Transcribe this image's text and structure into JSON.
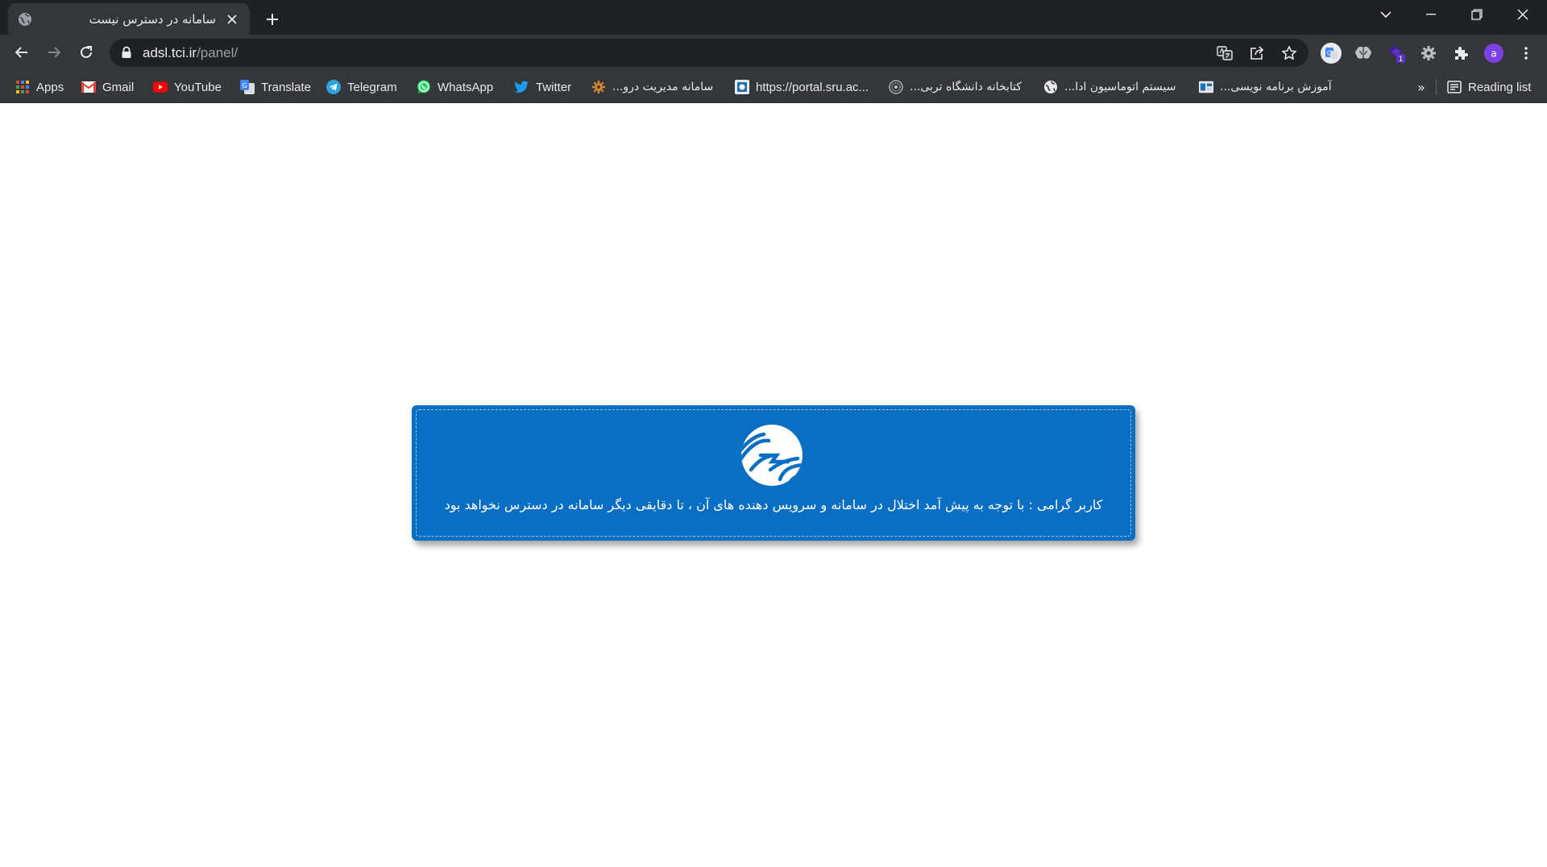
{
  "browser": {
    "tab": {
      "title": "سامانه در دسترس نیست",
      "favicon": "globe-icon"
    },
    "address_bar": {
      "host": "adsl.tci.ir",
      "path": "/panel/"
    },
    "bookmarks": [
      {
        "label": "Apps",
        "icon": "apps-grid-icon"
      },
      {
        "label": "Gmail",
        "icon": "gmail-icon"
      },
      {
        "label": "YouTube",
        "icon": "youtube-icon"
      },
      {
        "label": "Translate",
        "icon": "translate-icon"
      },
      {
        "label": "Telegram",
        "icon": "telegram-icon"
      },
      {
        "label": "WhatsApp",
        "icon": "whatsapp-icon"
      },
      {
        "label": "Twitter",
        "icon": "twitter-icon"
      },
      {
        "label": "سامانه مدیریت درو...",
        "icon": "gear-badge-icon"
      },
      {
        "label": "https://portal.sru.ac...",
        "icon": "portal-icon"
      },
      {
        "label": "کتابخانه دانشگاه تربی...",
        "icon": "library-icon"
      },
      {
        "label": "سیستم اتوماسیون ادا...",
        "icon": "globe-icon"
      },
      {
        "label": "آموزش برنامه نویسی...",
        "icon": "code-site-icon"
      }
    ],
    "bookmarks_more": "»",
    "reading_list": "Reading list",
    "profile_initial": "a",
    "extension_badge": "1"
  },
  "page": {
    "message": "کاربر گرامی : با توجه به پیش آمد اختلال در سامانه و سرویس دهنده های آن ، تا دقایقی دیگر سامانه در دسترس نخواهد بود",
    "logo": "tci-logo-icon"
  },
  "colors": {
    "notice_background": "#0a6fc2",
    "browser_frame": "#202124",
    "toolbar": "#35363a"
  }
}
